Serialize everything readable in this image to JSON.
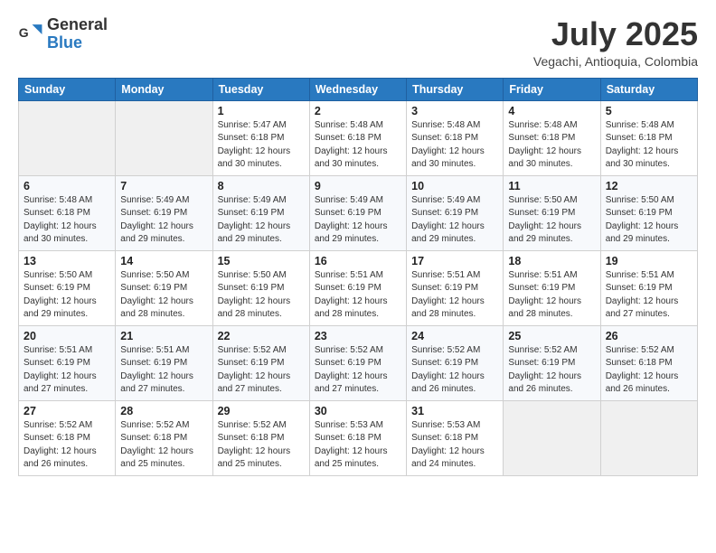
{
  "logo": {
    "line1": "General",
    "line2": "Blue"
  },
  "title": "July 2025",
  "location": "Vegachi, Antioquia, Colombia",
  "weekdays": [
    "Sunday",
    "Monday",
    "Tuesday",
    "Wednesday",
    "Thursday",
    "Friday",
    "Saturday"
  ],
  "weeks": [
    [
      {
        "day": "",
        "info": ""
      },
      {
        "day": "",
        "info": ""
      },
      {
        "day": "1",
        "info": "Sunrise: 5:47 AM\nSunset: 6:18 PM\nDaylight: 12 hours and 30 minutes."
      },
      {
        "day": "2",
        "info": "Sunrise: 5:48 AM\nSunset: 6:18 PM\nDaylight: 12 hours and 30 minutes."
      },
      {
        "day": "3",
        "info": "Sunrise: 5:48 AM\nSunset: 6:18 PM\nDaylight: 12 hours and 30 minutes."
      },
      {
        "day": "4",
        "info": "Sunrise: 5:48 AM\nSunset: 6:18 PM\nDaylight: 12 hours and 30 minutes."
      },
      {
        "day": "5",
        "info": "Sunrise: 5:48 AM\nSunset: 6:18 PM\nDaylight: 12 hours and 30 minutes."
      }
    ],
    [
      {
        "day": "6",
        "info": "Sunrise: 5:48 AM\nSunset: 6:18 PM\nDaylight: 12 hours and 30 minutes."
      },
      {
        "day": "7",
        "info": "Sunrise: 5:49 AM\nSunset: 6:19 PM\nDaylight: 12 hours and 29 minutes."
      },
      {
        "day": "8",
        "info": "Sunrise: 5:49 AM\nSunset: 6:19 PM\nDaylight: 12 hours and 29 minutes."
      },
      {
        "day": "9",
        "info": "Sunrise: 5:49 AM\nSunset: 6:19 PM\nDaylight: 12 hours and 29 minutes."
      },
      {
        "day": "10",
        "info": "Sunrise: 5:49 AM\nSunset: 6:19 PM\nDaylight: 12 hours and 29 minutes."
      },
      {
        "day": "11",
        "info": "Sunrise: 5:50 AM\nSunset: 6:19 PM\nDaylight: 12 hours and 29 minutes."
      },
      {
        "day": "12",
        "info": "Sunrise: 5:50 AM\nSunset: 6:19 PM\nDaylight: 12 hours and 29 minutes."
      }
    ],
    [
      {
        "day": "13",
        "info": "Sunrise: 5:50 AM\nSunset: 6:19 PM\nDaylight: 12 hours and 29 minutes."
      },
      {
        "day": "14",
        "info": "Sunrise: 5:50 AM\nSunset: 6:19 PM\nDaylight: 12 hours and 28 minutes."
      },
      {
        "day": "15",
        "info": "Sunrise: 5:50 AM\nSunset: 6:19 PM\nDaylight: 12 hours and 28 minutes."
      },
      {
        "day": "16",
        "info": "Sunrise: 5:51 AM\nSunset: 6:19 PM\nDaylight: 12 hours and 28 minutes."
      },
      {
        "day": "17",
        "info": "Sunrise: 5:51 AM\nSunset: 6:19 PM\nDaylight: 12 hours and 28 minutes."
      },
      {
        "day": "18",
        "info": "Sunrise: 5:51 AM\nSunset: 6:19 PM\nDaylight: 12 hours and 28 minutes."
      },
      {
        "day": "19",
        "info": "Sunrise: 5:51 AM\nSunset: 6:19 PM\nDaylight: 12 hours and 27 minutes."
      }
    ],
    [
      {
        "day": "20",
        "info": "Sunrise: 5:51 AM\nSunset: 6:19 PM\nDaylight: 12 hours and 27 minutes."
      },
      {
        "day": "21",
        "info": "Sunrise: 5:51 AM\nSunset: 6:19 PM\nDaylight: 12 hours and 27 minutes."
      },
      {
        "day": "22",
        "info": "Sunrise: 5:52 AM\nSunset: 6:19 PM\nDaylight: 12 hours and 27 minutes."
      },
      {
        "day": "23",
        "info": "Sunrise: 5:52 AM\nSunset: 6:19 PM\nDaylight: 12 hours and 27 minutes."
      },
      {
        "day": "24",
        "info": "Sunrise: 5:52 AM\nSunset: 6:19 PM\nDaylight: 12 hours and 26 minutes."
      },
      {
        "day": "25",
        "info": "Sunrise: 5:52 AM\nSunset: 6:19 PM\nDaylight: 12 hours and 26 minutes."
      },
      {
        "day": "26",
        "info": "Sunrise: 5:52 AM\nSunset: 6:18 PM\nDaylight: 12 hours and 26 minutes."
      }
    ],
    [
      {
        "day": "27",
        "info": "Sunrise: 5:52 AM\nSunset: 6:18 PM\nDaylight: 12 hours and 26 minutes."
      },
      {
        "day": "28",
        "info": "Sunrise: 5:52 AM\nSunset: 6:18 PM\nDaylight: 12 hours and 25 minutes."
      },
      {
        "day": "29",
        "info": "Sunrise: 5:52 AM\nSunset: 6:18 PM\nDaylight: 12 hours and 25 minutes."
      },
      {
        "day": "30",
        "info": "Sunrise: 5:53 AM\nSunset: 6:18 PM\nDaylight: 12 hours and 25 minutes."
      },
      {
        "day": "31",
        "info": "Sunrise: 5:53 AM\nSunset: 6:18 PM\nDaylight: 12 hours and 24 minutes."
      },
      {
        "day": "",
        "info": ""
      },
      {
        "day": "",
        "info": ""
      }
    ]
  ]
}
